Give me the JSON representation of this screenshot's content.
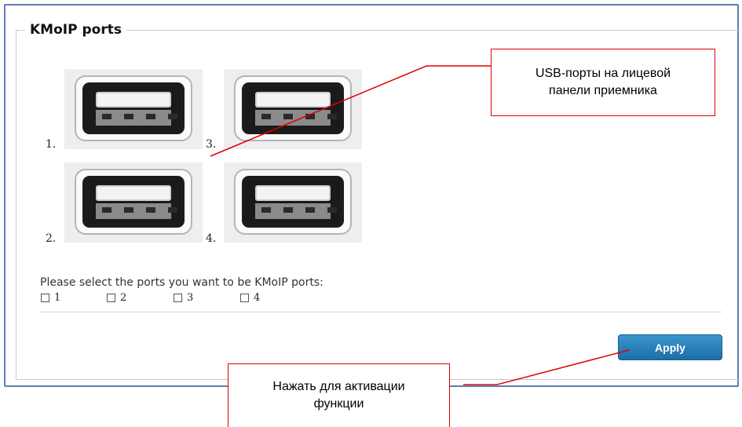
{
  "section": {
    "legend": "KMoIP ports"
  },
  "ports": [
    {
      "label": "1."
    },
    {
      "label": "2."
    },
    {
      "label": "3."
    },
    {
      "label": "4."
    }
  ],
  "form": {
    "prompt": "Please select the ports you want to be KMoIP ports:",
    "checkboxes": [
      {
        "label": "1",
        "checked": false
      },
      {
        "label": "2",
        "checked": false
      },
      {
        "label": "3",
        "checked": false
      },
      {
        "label": "4",
        "checked": false
      }
    ],
    "apply_label": "Apply"
  },
  "annotations": {
    "ports_callout": "USB-порты на лицевой\nпанели приемника",
    "apply_callout": "Нажать для активации\nфункции"
  },
  "colors": {
    "frame_border": "#5b7fb3",
    "apply_button": "#2a86c0",
    "callout_border": "#e00000"
  }
}
